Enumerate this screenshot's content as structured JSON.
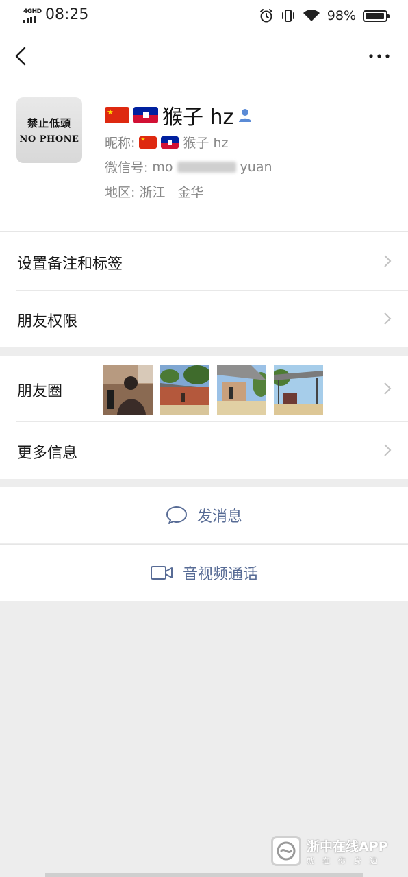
{
  "status_bar": {
    "network": "4GHD",
    "time": "08:25",
    "battery_percent": "98%",
    "battery_level": 0.98,
    "icons": [
      "alarm-icon",
      "vibrate-icon",
      "wifi-icon",
      "battery-icon"
    ]
  },
  "nav": {
    "back_icon": "chevron-left-icon",
    "more_icon": "more-dots-icon"
  },
  "profile": {
    "avatar": {
      "text_cn": "禁止低頭",
      "text_en": "NO PHONE"
    },
    "name": "猴子 hz",
    "name_flags": [
      "china-flag",
      "haiti-flag"
    ],
    "badge_icon": "contact-person-icon",
    "nickname_label": "昵称:",
    "nickname_value": "猴子 hz",
    "wechat_id_label": "微信号:",
    "wechat_id_prefix": "mo",
    "wechat_id_suffix": "yuan",
    "region_label": "地区:",
    "region_province": "浙江",
    "region_city": "金华"
  },
  "menu": {
    "remark_tags": "设置备注和标签",
    "friend_permissions": "朋友权限",
    "moments": "朋友圈",
    "more_info": "更多信息"
  },
  "actions": {
    "send_message": "发消息",
    "video_call": "音视频通话"
  },
  "watermark": {
    "title": "浙中在线APP",
    "subtitle": "就在你身边"
  },
  "colors": {
    "link_blue": "#576b95",
    "background": "#ededed",
    "card": "#ffffff",
    "secondary_text": "#888888"
  }
}
